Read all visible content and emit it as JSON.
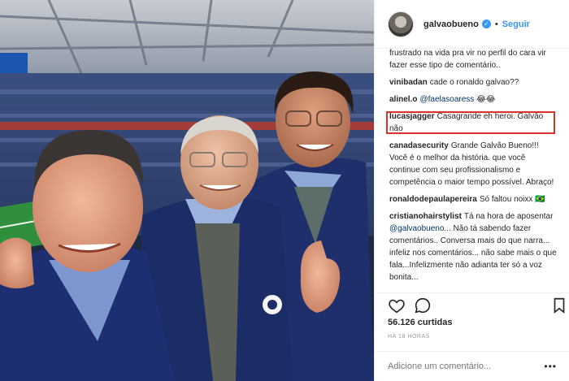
{
  "post": {
    "username": "galvaobueno",
    "verified_icon": "verified-badge-icon",
    "follow_label": "Seguir",
    "likes": "56.126 curtidas",
    "timestamp": "HÁ 18 HORAS",
    "comment_placeholder": "Adicione um comentário...",
    "more_icon": "ellipsis-icon"
  },
  "comments": [
    {
      "user": "",
      "text": "frustrado na vida pra vir no perfil do cara vir fazer esse tipo de comentário.."
    },
    {
      "user": "vinibadan",
      "text": "cade o ronaldo galvao??"
    },
    {
      "user": "alinel.o",
      "mention": "@faelasoaress",
      "text": "😂😂"
    },
    {
      "user": "lucasjagger",
      "text": "Casagrande eh heroi. Galvão não"
    },
    {
      "user": "canadasecurity",
      "text": "Grande Galvão Bueno!!! Você é o melhor da história. que você continue com seu profissionalismo e competência o maior tempo possível. Abraço!"
    },
    {
      "user": "ronaldodepaulapereira",
      "text": "Só faltou noixx 🇧🇷"
    },
    {
      "user": "cristianohairstylist",
      "text": "Tá na hora de aposentar",
      "mention2": "@galvaobueno",
      "text2": "... Não tá sabendo fazer comentários.. Conversa mais do que narra... infeliz nos comentários... não sabe mais o que fala...Infelizmente não adianta ter só a voz bonita..."
    },
    {
      "user": "...",
      "text": ""
    }
  ],
  "icons": {
    "like": "heart-icon",
    "comment": "comment-bubble-icon",
    "save": "bookmark-icon"
  },
  "colors": {
    "link_blue": "#3897f0",
    "highlight_red": "#d7322b",
    "jacket_navy": "#1f2f6b"
  }
}
